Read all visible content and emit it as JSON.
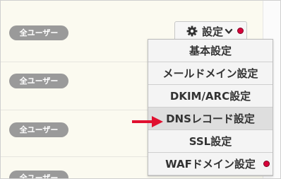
{
  "rows": [
    {
      "badge": "全ユーザー"
    },
    {
      "badge": "全ユーザー"
    },
    {
      "badge": "全ユーザー"
    },
    {
      "badge": "全ユーザー"
    }
  ],
  "settings": {
    "label": "設定"
  },
  "menu": {
    "items": [
      {
        "label": "基本設定"
      },
      {
        "label": "メールドメイン設定"
      },
      {
        "label": "DKIM/ARC設定"
      },
      {
        "label": "DNSレコード設定"
      },
      {
        "label": "SSL設定"
      },
      {
        "label": "WAFドメイン設定"
      }
    ]
  },
  "colors": {
    "notification_dot": "#d9003a",
    "pointer_arrow": "#e0102f",
    "badge_bg": "#9a9a9a"
  },
  "icons": {
    "settings": "gear-icon",
    "dropdown": "chevron-down-icon",
    "pointer": "arrow-right-icon"
  }
}
